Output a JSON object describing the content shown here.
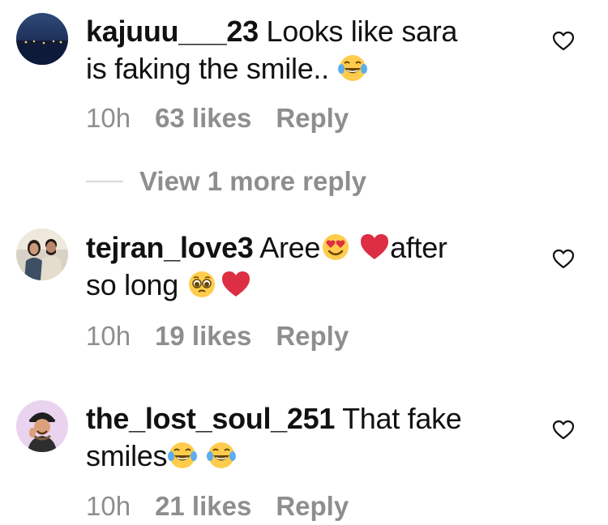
{
  "comments": [
    {
      "username": "kajuuu___23",
      "text_lines": [
        "Looks like sara",
        "is faking the smile.. "
      ],
      "time": "10h",
      "likes": "63 likes",
      "reply": "Reply",
      "emojis": [
        "laughing-tears"
      ]
    },
    {
      "username": "tejran_love3",
      "text_parts": [
        "Aree",
        "after",
        "so long"
      ],
      "time": "10h",
      "likes": "19 likes",
      "reply": "Reply",
      "emojis": [
        "heart-eyes",
        "red-heart",
        "pleading-face",
        "red-heart"
      ]
    },
    {
      "username": "the_lost_soul_251",
      "text_parts": [
        "That fake",
        "smiles"
      ],
      "time": "10h",
      "likes": "21 likes",
      "reply": "Reply",
      "emojis": [
        "laughing-tears",
        "laughing-tears"
      ]
    }
  ],
  "view_more": "View 1 more reply",
  "colors": {
    "text": "#111111",
    "meta": "#8e8e8e",
    "heart": "#e0245e"
  }
}
